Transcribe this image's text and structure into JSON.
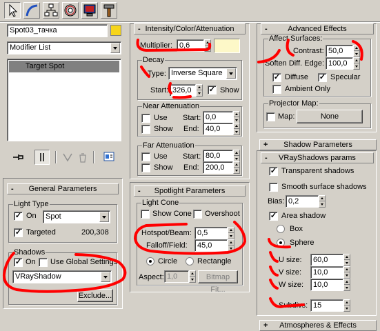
{
  "toolbar": {
    "tabs": [
      {
        "name": "create-tab",
        "icon": "pointer-icon"
      },
      {
        "name": "modify-tab",
        "icon": "arc-icon"
      },
      {
        "name": "hierarchy-tab",
        "icon": "hierarchy-icon"
      },
      {
        "name": "motion-tab",
        "icon": "wheel-icon"
      },
      {
        "name": "display-tab",
        "icon": "monitor-icon"
      },
      {
        "name": "utilities-tab",
        "icon": "hammer-icon"
      }
    ]
  },
  "object": {
    "name": "Spot03_тачка",
    "color": "#f7d51a"
  },
  "modifier_list": {
    "label": "Modifier List",
    "stack_items": [
      "Target Spot"
    ]
  },
  "general_parameters": {
    "title": "General Parameters",
    "light_type_label": "Light Type",
    "on_label": "On",
    "on_checked": true,
    "type_value": "Spot",
    "targeted_label": "Targeted",
    "targeted_checked": true,
    "target_distance": "200,308",
    "shadows_label": "Shadows",
    "shadows_on_label": "On",
    "shadows_on_checked": true,
    "use_global_label": "Use Global Settings",
    "use_global_checked": false,
    "shadow_type": "VRayShadow",
    "exclude_label": "Exclude..."
  },
  "intensity": {
    "title": "Intensity/Color/Attenuation",
    "multiplier_label": "Multiplier:",
    "multiplier_value": "0,6",
    "light_color": "#fdf8c8",
    "decay_label": "Decay",
    "type_label": "Type:",
    "type_value": "Inverse Square",
    "start_label": "Start:",
    "start_value": "326,0",
    "show_label": "Show",
    "show_checked": true,
    "near_label": "Near Attenuation",
    "near_use": "Use",
    "near_show": "Show",
    "near_start_label": "Start:",
    "near_start": "0,0",
    "near_end_label": "End:",
    "near_end": "40,0",
    "far_label": "Far Attenuation",
    "far_use": "Use",
    "far_show": "Show",
    "far_start_label": "Start:",
    "far_start": "80,0",
    "far_end_label": "End:",
    "far_end": "200,0"
  },
  "spotlight": {
    "title": "Spotlight Parameters",
    "cone_label": "Light Cone",
    "show_cone_label": "Show Cone",
    "overshoot_label": "Overshoot",
    "hotspot_label": "Hotspot/Beam:",
    "hotspot_value": "0,5",
    "falloff_label": "Falloff/Field:",
    "falloff_value": "45,0",
    "circle_label": "Circle",
    "rectangle_label": "Rectangle",
    "aspect_label": "Aspect:",
    "aspect_value": "1,0",
    "bitmap_fit_label": "Bitmap Fit..."
  },
  "advanced_effects": {
    "title": "Advanced Effects",
    "affect_surfaces_label": "Affect Surfaces:",
    "contrast_label": "Contrast:",
    "contrast_value": "50,0",
    "soften_label": "Soften Diff. Edge:",
    "soften_value": "100,0",
    "diffuse_label": "Diffuse",
    "diffuse_checked": true,
    "specular_label": "Specular",
    "specular_checked": true,
    "ambient_label": "Ambient Only",
    "ambient_checked": false,
    "projector_label": "Projector Map:",
    "map_label": "Map:",
    "map_button": "None"
  },
  "shadow_parameters": {
    "title": "Shadow Parameters"
  },
  "vray_shadows": {
    "title": "VRayShadows params",
    "transparent_label": "Transparent shadows",
    "transparent_checked": true,
    "smooth_label": "Smooth surface shadows",
    "smooth_checked": false,
    "bias_label": "Bias:",
    "bias_value": "0,2",
    "area_label": "Area shadow",
    "area_checked": true,
    "box_label": "Box",
    "sphere_label": "Sphere",
    "u_label": "U size:",
    "u_value": "60,0",
    "v_label": "V size:",
    "v_value": "10,0",
    "w_label": "W size:",
    "w_value": "10,0",
    "subdivs_label": "Subdivs:",
    "subdivs_value": "15"
  },
  "atmospheres": {
    "title": "Atmospheres & Effects"
  },
  "annotation_color": "#ff0000"
}
